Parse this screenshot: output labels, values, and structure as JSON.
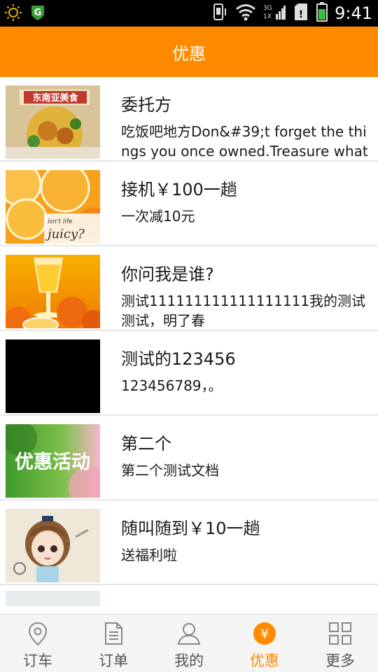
{
  "statusbar": {
    "time": "9:41",
    "network_label": "3G\n1X"
  },
  "header": {
    "title": "优惠"
  },
  "items": [
    {
      "title": "委托方",
      "desc": "吃饭吧地方Don&#39;t forget the things you once owned.Treasure what you can't get...",
      "thumb_caption": "东南亚美食"
    },
    {
      "title": "接机￥100一趟",
      "desc": "一次减10元",
      "thumb_caption": "isn't life juicy?"
    },
    {
      "title": "你问我是谁?",
      "desc": "测试111111111111111111我的测试测试，明了春"
    },
    {
      "title": "测试的123456",
      "desc": "123456789，。"
    },
    {
      "title": "第二个",
      "desc": "第二个测试文档",
      "thumb_caption": "优惠活动"
    },
    {
      "title": "随叫随到￥10一趟",
      "desc": "送福利啦"
    }
  ],
  "nav": [
    {
      "label": "订车",
      "icon": "location-pin-icon"
    },
    {
      "label": "订单",
      "icon": "document-icon"
    },
    {
      "label": "我的",
      "icon": "person-icon"
    },
    {
      "label": "优惠",
      "icon": "yen-coin-icon",
      "glyph": "¥"
    },
    {
      "label": "更多",
      "icon": "grid-icon"
    }
  ],
  "colors": {
    "accent": "#ff8a00",
    "statusbar": "#000000",
    "divider": "#e6e6e6"
  }
}
